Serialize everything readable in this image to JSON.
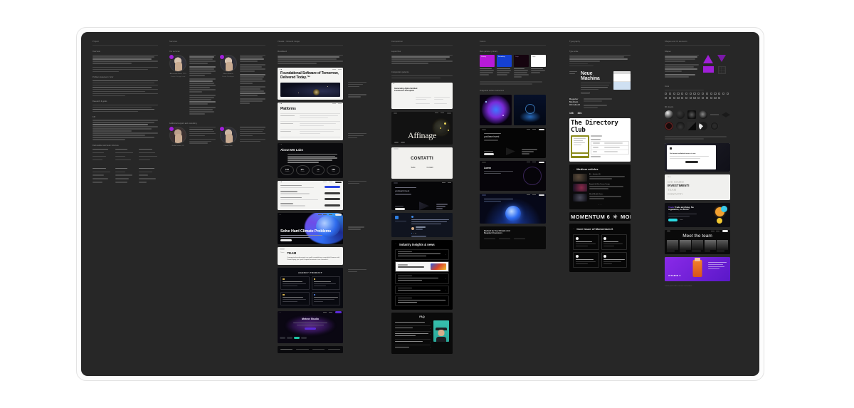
{
  "app": {
    "background": "#ffffff",
    "canvas_color": "#272727",
    "frame_border": "#e3e3e3"
  },
  "columns": [
    {
      "id": "project",
      "title": "Project",
      "sections": [
        {
          "label": "Overview"
        },
        {
          "label": "Problem statement / brief"
        },
        {
          "label": "Research & goals"
        },
        {
          "label": "KPI"
        },
        {
          "label": "Deliverables and team structure"
        }
      ]
    },
    {
      "id": "services",
      "title": "Services",
      "sections": [
        {
          "label": "Our services"
        },
        {
          "label": "Additional support and consulting"
        }
      ],
      "people": [
        {
          "name": "Alessandro Rossi, CTO",
          "role": "Product Design Lead"
        },
        {
          "name": "Marco Bianchi",
          "role": "Senior Developer"
        },
        {
          "name": "Giulia Ferrari, UX",
          "role": "Research Lead"
        },
        {
          "name": "Chiara Conti",
          "role": "Brand Strategy"
        }
      ]
    },
    {
      "id": "visuals",
      "title": "Visuals / Inbound image",
      "sections": [
        {
          "label": "Moodboard"
        }
      ],
      "cards": [
        {
          "name": "foundational-software-card",
          "headline": "Foundational Software of Tomorrow, Delivered Today.™",
          "theme": "light"
        },
        {
          "name": "platforms-card",
          "headline": "Platforms",
          "theme": "light"
        },
        {
          "name": "about-ms-labs-card",
          "headline": "About MS Labs",
          "theme": "dark",
          "kpis": [
            {
              "value": "108",
              "label": "Projects"
            },
            {
              "value": "92+",
              "label": "Clients"
            },
            {
              "value": "10",
              "label": "Years"
            },
            {
              "value": "58k",
              "label": "Users"
            }
          ]
        },
        {
          "name": "dashboard-card",
          "headline": "Leadership",
          "theme": "light"
        },
        {
          "name": "climate-card",
          "headline": "Solve Hard Climate Problems",
          "theme": "dark"
        },
        {
          "name": "team-card",
          "headline": "TEAM",
          "theme": "light",
          "body": "Il composto da professionisti con profili consolidati nei campi della Finanza e del Private Equity, per i quali l'aspetto finanziario è uno 'strumento'."
        },
        {
          "name": "agency-card",
          "headline": "AGENCY PRODUCT",
          "theme": "dark"
        },
        {
          "name": "studio-card",
          "headline": "Meteor Studio",
          "theme": "dark"
        }
      ]
    },
    {
      "id": "composition",
      "title": "Composition",
      "sections": [
        {
          "label": "Layout flow"
        },
        {
          "label": "Composition patterns"
        }
      ],
      "cards": [
        {
          "name": "concept-card",
          "headline": "Generating Alpha Inmitted Continuous Disruption",
          "theme": "light"
        },
        {
          "name": "affinage-card",
          "headline": "Affinage",
          "theme": "dark"
        },
        {
          "name": "contatti-card",
          "headline": "CONTATTI",
          "theme": "light",
          "links": [
            "Sede",
            "Contatti"
          ]
        },
        {
          "name": "product-hero-card",
          "headline": "youtlearninvest",
          "theme": "dark"
        },
        {
          "name": "quote-card",
          "headline": "Reviews",
          "theme": "dark"
        },
        {
          "name": "insights-card",
          "headline": "Industry insights & news",
          "theme": "dark"
        },
        {
          "name": "faq-card",
          "headline": "FAQ",
          "theme": "dark"
        }
      ]
    },
    {
      "id": "colors",
      "title": "Colors",
      "sections": [
        {
          "label": "Main palette / primary"
        },
        {
          "label": "Image and texture references"
        }
      ],
      "swatches": [
        {
          "name": "magenta",
          "hex": "#b81ad8",
          "label": "Primary"
        },
        {
          "name": "blue",
          "hex": "#1540d2",
          "label": "Secondary"
        },
        {
          "name": "deep-purple",
          "hex": "#15040f",
          "label": "Deep"
        },
        {
          "name": "white",
          "hex": "#ffffff",
          "label": "Light"
        }
      ],
      "cards": [
        {
          "name": "network-image",
          "theme": "dark"
        },
        {
          "name": "datasphere-image",
          "theme": "dark"
        },
        {
          "name": "fintech-hero",
          "headline": "youtlearninvest",
          "theme": "dark"
        },
        {
          "name": "gradient-hero",
          "headline": "Lorem",
          "theme": "dark"
        },
        {
          "name": "blue-orb-card",
          "theme": "dark"
        },
        {
          "name": "backed-by-card",
          "headline": "Backed by Top Climate And Deeptech Investors",
          "theme": "dark"
        }
      ]
    },
    {
      "id": "typography",
      "title": "Typography",
      "sections": [
        {
          "label": "Type scale"
        }
      ],
      "cards": [
        {
          "name": "neue-machina-card",
          "headline": "Neue Machina",
          "theme": "dark",
          "specs": [
            "Regular",
            "Medium",
            "Ultrabold"
          ],
          "sizes": [
            "108",
            "82k"
          ]
        },
        {
          "name": "directory-club-card",
          "headline": "The Directory Club",
          "theme": "light"
        },
        {
          "name": "medium-articles-card",
          "headline": "Medium articles",
          "theme": "dark",
          "items": [
            "AI — Interface Kit",
            "Beyond the Blue Screen: Design",
            "Mental Models Series"
          ]
        },
        {
          "name": "momentum-marquee",
          "headline": "MOMENTUM 6",
          "theme": "dark"
        },
        {
          "name": "core-issue-card",
          "headline": "Core Issue of Momentum 6",
          "theme": "dark"
        }
      ]
    },
    {
      "id": "shapes",
      "title": "Shapes and UI elements",
      "sections": [
        {
          "label": "Shapes"
        },
        {
          "label": "Icons"
        },
        {
          "label": "3D objects"
        }
      ],
      "cards": [
        {
          "name": "white-modal-card",
          "headline": "Get instant unlimited access to our",
          "theme": "light"
        },
        {
          "name": "investimenti-card",
          "headline": "INVESTIMENTI",
          "theme": "light",
          "menu": [
            "CHI SIAMO",
            "INVESTIMENTI",
            "TEAM",
            "CONTATTI"
          ]
        },
        {
          "name": "trade-anything-card",
          "headline": "Trade anything. No regulation, no limits.",
          "theme": "dark"
        },
        {
          "name": "meet-the-team-card",
          "headline": "Meet the team",
          "theme": "dark"
        },
        {
          "name": "vitamin-c-card",
          "headline": "VITAMIN C",
          "theme": "purple"
        }
      ],
      "footer_note": "Lorem ipsum dolor sit amet consectetur"
    }
  ]
}
